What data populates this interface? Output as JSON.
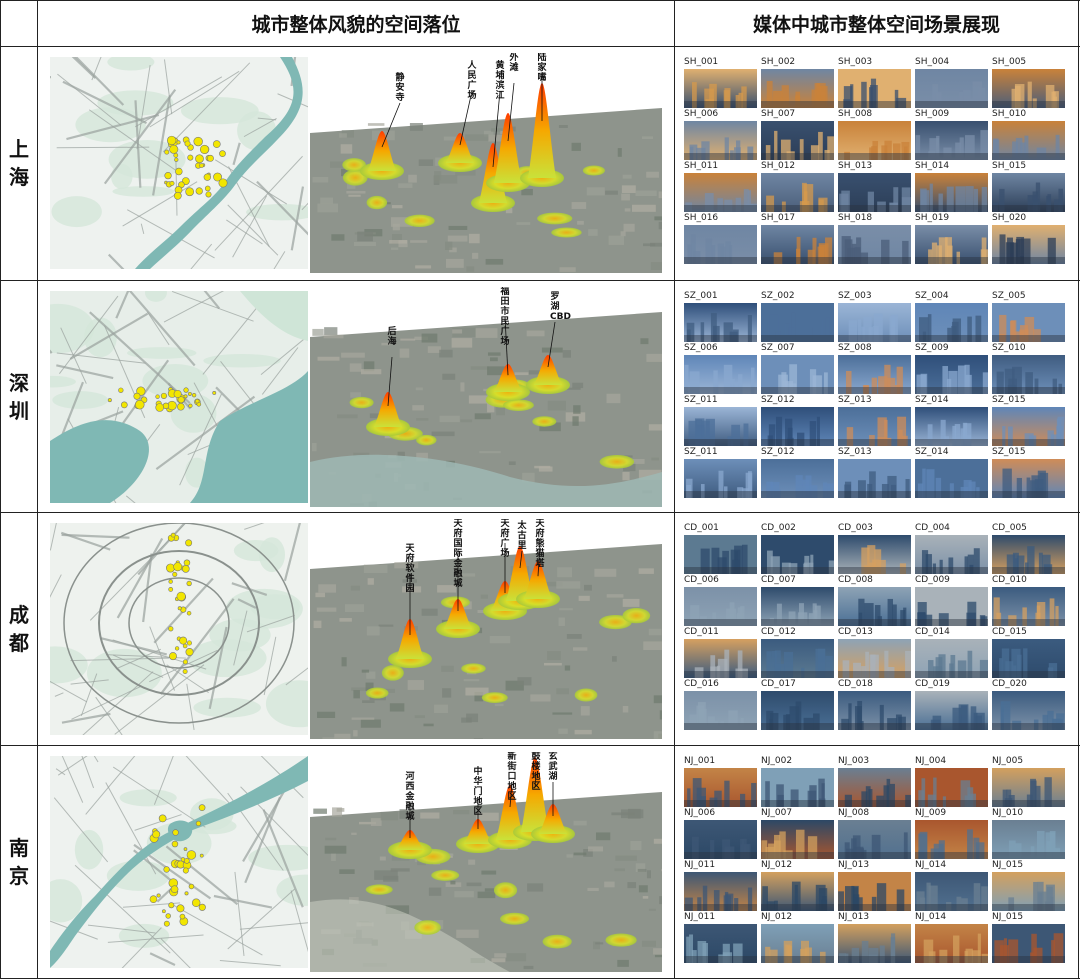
{
  "headers": {
    "col1": "城市整体风貌的空间落位",
    "col2": "媒体中城市整体空间场景展现"
  },
  "cities": [
    {
      "key": "shanghai",
      "name_chars": [
        "上",
        "海"
      ],
      "peak_labels": [
        "静安寺",
        "人民广场",
        "黄埔滨江",
        "外滩",
        "陆家嘴"
      ],
      "thumbs": [
        "SH_001",
        "SH_002",
        "SH_003",
        "SH_004",
        "SH_005",
        "SH_006",
        "SH_007",
        "SH_008",
        "SH_009",
        "SH_010",
        "SH_011",
        "SH_012",
        "SH_013",
        "SH_014",
        "SH_015",
        "SH_016",
        "SH_017",
        "SH_018",
        "SH_019",
        "SH_020"
      ]
    },
    {
      "key": "shenzhen",
      "name_chars": [
        "深",
        "圳"
      ],
      "peak_labels": [
        "后海",
        "福田市民广场",
        "罗湖CBD"
      ],
      "thumbs": [
        "SZ_001",
        "SZ_002",
        "SZ_003",
        "SZ_004",
        "SZ_005",
        "SZ_006",
        "SZ_007",
        "SZ_008",
        "SZ_009",
        "SZ_010",
        "SZ_011",
        "SZ_012",
        "SZ_013",
        "SZ_014",
        "SZ_015",
        "SZ_011",
        "SZ_012",
        "SZ_013",
        "SZ_014",
        "SZ_015"
      ]
    },
    {
      "key": "chengdu",
      "name_chars": [
        "成",
        "都"
      ],
      "peak_labels": [
        "天府软件园",
        "天府国际金融城",
        "天府广场",
        "太古里",
        "天府熊猫塔"
      ],
      "thumbs": [
        "CD_001",
        "CD_002",
        "CD_003",
        "CD_004",
        "CD_005",
        "CD_006",
        "CD_007",
        "CD_008",
        "CD_009",
        "CD_010",
        "CD_011",
        "CD_012",
        "CD_013",
        "CD_014",
        "CD_015",
        "CD_016",
        "CD_017",
        "CD_018",
        "CD_019",
        "CD_020"
      ]
    },
    {
      "key": "nanjing",
      "name_chars": [
        "南",
        "京"
      ],
      "peak_labels": [
        "河西金融城",
        "中华门地区",
        "新街口地区",
        "鼓楼地区",
        "玄武湖"
      ],
      "thumbs": [
        "NJ_001",
        "NJ_002",
        "NJ_003",
        "NJ_004",
        "NJ_005",
        "NJ_006",
        "NJ_007",
        "NJ_008",
        "NJ_009",
        "NJ_010",
        "NJ_011",
        "NJ_012",
        "NJ_013",
        "NJ_014",
        "NJ_015",
        "NJ_011",
        "NJ_012",
        "NJ_013",
        "NJ_014",
        "NJ_015"
      ]
    }
  ],
  "colors": {
    "water": "#7fb8b4",
    "road": "#9aa29e",
    "point": "#f2e600",
    "heat_low": "#c9e23a",
    "heat_high": "#ff3c00"
  }
}
